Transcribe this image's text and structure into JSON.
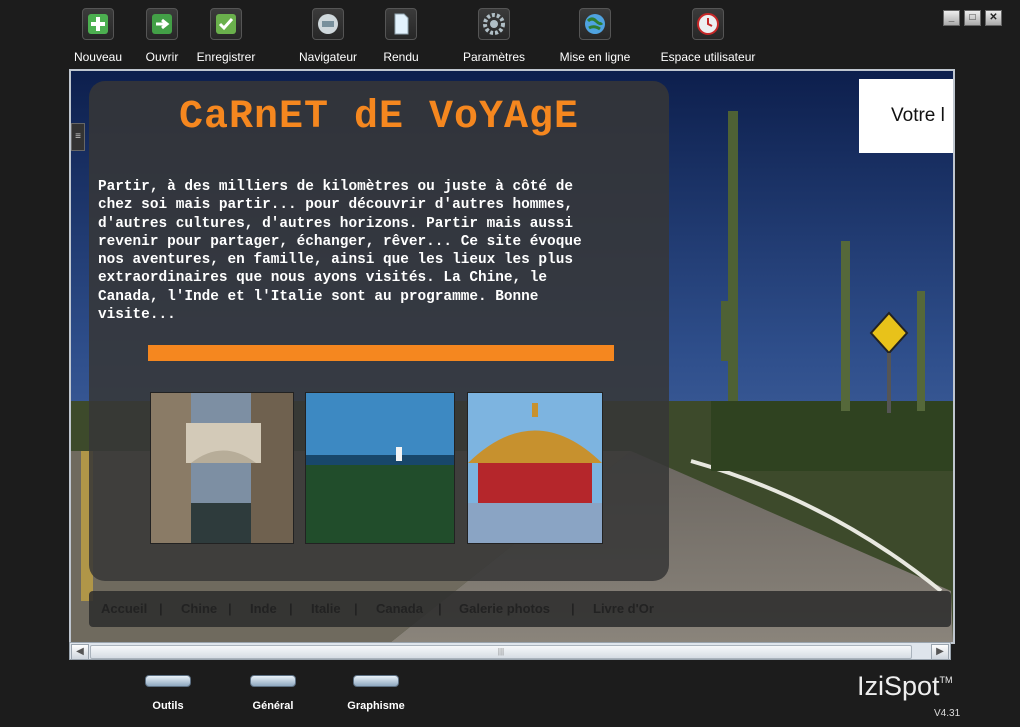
{
  "toolbar": {
    "items": [
      {
        "label": "Nouveau",
        "icon": "plus-icon"
      },
      {
        "label": "Ouvrir",
        "icon": "open-arrow-icon"
      },
      {
        "label": "Enregistrer",
        "icon": "check-icon"
      },
      {
        "label": "Navigateur",
        "icon": "browser-icon"
      },
      {
        "label": "Rendu",
        "icon": "document-icon"
      },
      {
        "label": "Paramètres",
        "icon": "gear-icon"
      },
      {
        "label": "Mise en ligne",
        "icon": "globe-icon"
      },
      {
        "label": "Espace utilisateur",
        "icon": "user-clock-icon"
      }
    ]
  },
  "page": {
    "title": "CaRnET dE VoYAgE",
    "intro": "Partir, à des milliers de kilomètres ou juste à côté de\nchez soi mais partir... pour découvrir d'autres hommes,\nd'autres cultures, d'autres horizons. Partir mais aussi\nrevenir pour partager, échanger, rêver... Ce site évoque\nnos aventures, en famille, ainsi que les lieux les plus\nextraordinaires que nous ayons visités. La Chine, le\nCanada, l'Inde et l'Italie sont au programme. Bonne\nvisite...",
    "banner": "Votre l",
    "nav": [
      "Accueil",
      "Chine",
      "Inde",
      "Italie",
      "Canada",
      "Galerie photos",
      "Livre d'Or"
    ],
    "nav_separator": "|"
  },
  "bottom_tabs": [
    "Outils",
    "Général",
    "Graphisme"
  ],
  "brand": {
    "name": "IziSpot",
    "tm": "TM",
    "version": "V4.31"
  },
  "colors": {
    "accent": "#f5871f",
    "background": "#1c1c1c",
    "frame_border": "#bfc6cf"
  }
}
